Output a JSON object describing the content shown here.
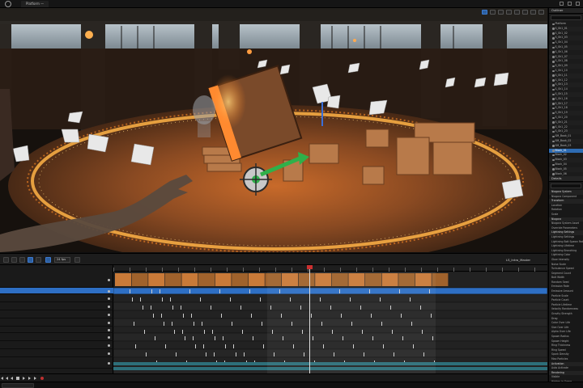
{
  "app": {
    "tab_label": "Platform —"
  },
  "sequencer": {
    "fps_label": "24 fps",
    "sequence_name": "LS_Intro_Master",
    "tracks": [
      {
        "name": "",
        "selected": false
      },
      {
        "name": "",
        "selected": true
      },
      {
        "name": "",
        "selected": false
      },
      {
        "name": "",
        "selected": false
      },
      {
        "name": "",
        "selected": false
      },
      {
        "name": "",
        "selected": false
      },
      {
        "name": "",
        "selected": false
      },
      {
        "name": "",
        "selected": false
      },
      {
        "name": "",
        "selected": false
      },
      {
        "name": "",
        "selected": false
      },
      {
        "name": "",
        "selected": false
      },
      {
        "name": "",
        "selected": false
      }
    ]
  },
  "outliner": {
    "title": "Outliner",
    "items": [
      "Platform",
      "S_Sh1_01",
      "S_Sh1_02",
      "S_Sh1_03",
      "S_Sh1_04",
      "S_Sh1_05",
      "S_Sh1_06",
      "S_Sh1_07",
      "S_Sh1_08",
      "S_Sh1_09",
      "S_Sh1_10",
      "S_Sh1_11",
      "S_Sh1_12",
      "S_Sh1_13",
      "S_Sh1_14",
      "S_Sh1_15",
      "S_Sh1_16",
      "S_Sh1_17",
      "S_Sh1_18",
      "S_Sh1_19",
      "S_Sh1_20",
      "S_Sh1_21",
      "S_Sh1_22",
      "S_Sh1_23",
      "SM_Book_01",
      "SM_Book_02",
      "SM_Book_03",
      "Block_01",
      "Block_02",
      "Block_03",
      "Block_04",
      "Block_05",
      "Block_06"
    ],
    "selected_index": 27
  },
  "details": {
    "title": "Details",
    "rows": [
      {
        "label": "Niagara System",
        "cat": true
      },
      {
        "label": "Niagara Component",
        "cat": false
      },
      {
        "label": "Transform",
        "cat": true
      },
      {
        "label": "Location",
        "cat": false
      },
      {
        "label": "Rotation",
        "cat": false
      },
      {
        "label": "Scale",
        "cat": false
      },
      {
        "label": "Niagara",
        "cat": true
      },
      {
        "label": "Niagara System Asset",
        "cat": false
      },
      {
        "label": "Override Parameters",
        "cat": false
      },
      {
        "label": "Lightning Settings",
        "cat": true
      },
      {
        "label": "Lightning Settings",
        "cat": false
      },
      {
        "label": "Lightning Bolt Spawn Rate",
        "cat": false
      },
      {
        "label": "Lightning Lifetime",
        "cat": false
      },
      {
        "label": "Lightning Branching",
        "cat": false
      },
      {
        "label": "Lightning Color",
        "cat": false
      },
      {
        "label": "Glow Intensity",
        "cat": false
      },
      {
        "label": "Noise Scale",
        "cat": false
      },
      {
        "label": "Turbulence Speed",
        "cat": false
      },
      {
        "label": "Segment Count",
        "cat": false
      },
      {
        "label": "Bolt Width",
        "cat": false
      },
      {
        "label": "Random Seed",
        "cat": false
      },
      {
        "label": "Emission Rate",
        "cat": false
      },
      {
        "label": "Emissive Amount",
        "cat": false
      },
      {
        "label": "Particle Scale",
        "cat": false
      },
      {
        "label": "Particle Count",
        "cat": false
      },
      {
        "label": "Particle Lifetime",
        "cat": false
      },
      {
        "label": "Velocity Randomness",
        "cat": false
      },
      {
        "label": "Gravity Strength",
        "cat": false
      },
      {
        "label": "Drag",
        "cat": false
      },
      {
        "label": "Color Over Life",
        "cat": false
      },
      {
        "label": "Size Over Life",
        "cat": false
      },
      {
        "label": "Alpha Over Life",
        "cat": false
      },
      {
        "label": "Spawn Radius",
        "cat": false
      },
      {
        "label": "Spawn Height",
        "cat": false
      },
      {
        "label": "Ring Thickness",
        "cat": false
      },
      {
        "label": "Ring Speed",
        "cat": false
      },
      {
        "label": "Spark Density",
        "cat": false
      },
      {
        "label": "Max Particles",
        "cat": false
      },
      {
        "label": "Activation",
        "cat": true
      },
      {
        "label": "Auto Activate",
        "cat": false
      },
      {
        "label": "Rendering",
        "cat": true
      },
      {
        "label": "Visible",
        "cat": false
      },
      {
        "label": "Hidden in Game",
        "cat": false
      },
      {
        "label": "LOD",
        "cat": true
      },
      {
        "label": "Collision",
        "cat": false
      },
      {
        "label": "Physics",
        "cat": false
      }
    ]
  },
  "colors": {
    "accent": "#2e6fc4",
    "sparks": "#ff9a30",
    "gizmo_arrow": "#2fb04a",
    "playhead": "#cc3030"
  },
  "icons": [
    "gizmo-icon",
    "play-icon",
    "pause-icon",
    "stop-icon",
    "skip-back-icon",
    "skip-forward-icon",
    "eye-icon",
    "search-icon",
    "close-icon",
    "minimize-icon",
    "maximize-icon"
  ]
}
